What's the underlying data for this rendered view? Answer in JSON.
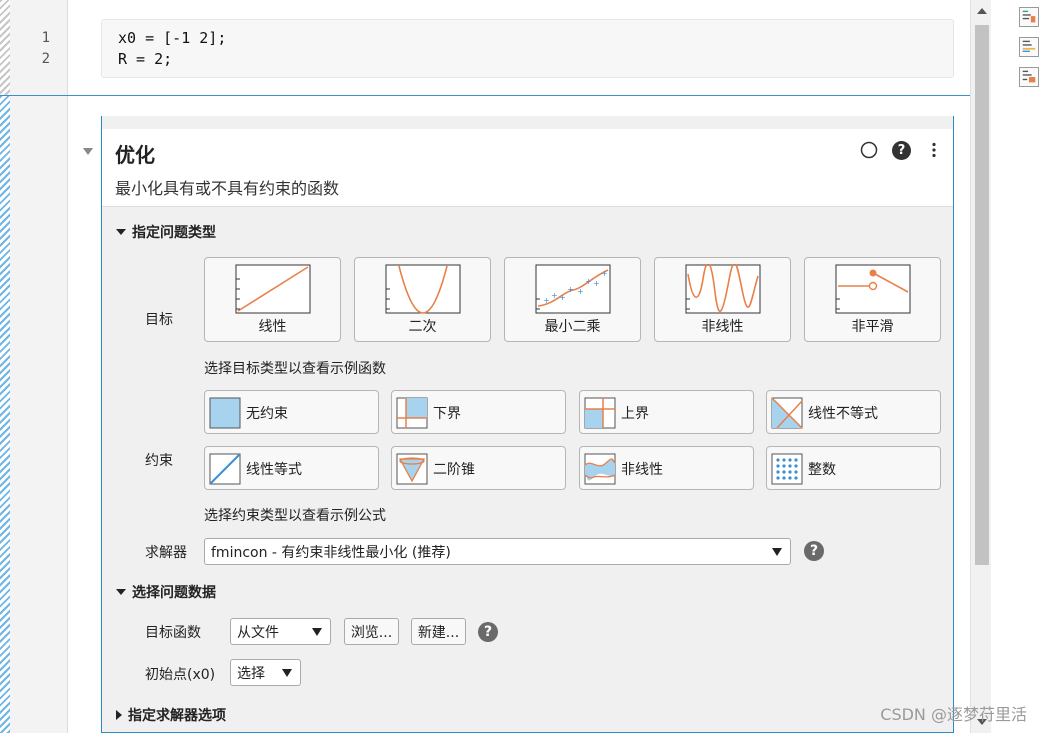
{
  "code": {
    "line_numbers": [
      "1",
      "2"
    ],
    "lines": [
      "x0 = [-1 2];",
      "R = 2;"
    ]
  },
  "task": {
    "title": "优化",
    "subtitle": "最小化具有或不具有约束的函数",
    "header_icons": [
      "circle-icon",
      "help-icon",
      "more-options-icon"
    ]
  },
  "section_problem_type": {
    "label": "指定问题类型",
    "objective_label": "目标",
    "objectives": [
      {
        "label": "线性",
        "icon": "linear-plot-icon"
      },
      {
        "label": "二次",
        "icon": "quadratic-plot-icon"
      },
      {
        "label": "最小二乘",
        "icon": "least-squares-plot-icon"
      },
      {
        "label": "非线性",
        "icon": "nonlinear-plot-icon"
      },
      {
        "label": "非平滑",
        "icon": "nonsmooth-plot-icon"
      }
    ],
    "objective_hint": "选择目标类型以查看示例函数",
    "constraint_label": "约束",
    "constraints": [
      {
        "label": "无约束",
        "icon": "unconstrained-icon"
      },
      {
        "label": "下界",
        "icon": "lower-bound-icon"
      },
      {
        "label": "上界",
        "icon": "upper-bound-icon"
      },
      {
        "label": "线性不等式",
        "icon": "linear-inequality-icon"
      },
      {
        "label": "线性等式",
        "icon": "linear-equality-icon"
      },
      {
        "label": "二阶锥",
        "icon": "second-order-cone-icon"
      },
      {
        "label": "非线性",
        "icon": "nonlinear-constraint-icon"
      },
      {
        "label": "整数",
        "icon": "integer-icon"
      }
    ],
    "constraint_hint": "选择约束类型以查看示例公式",
    "solver_label": "求解器",
    "solver_value": "fmincon - 有约束非线性最小化 (推荐)"
  },
  "section_problem_data": {
    "label": "选择问题数据",
    "objective_fn_label": "目标函数",
    "objective_fn_value": "从文件",
    "browse_label": "浏览...",
    "new_label": "新建...",
    "x0_label": "初始点(x0)",
    "x0_value": "选择"
  },
  "section_solver_options": {
    "label": "指定求解器选项"
  },
  "watermark": "CSDN @逐梦苻里活",
  "colors": {
    "accent_blue": "#2a8bc9",
    "plot_orange": "#e8804a",
    "constraint_blue": "#a7d3ef",
    "scatter_blue": "#3a8fd6"
  }
}
